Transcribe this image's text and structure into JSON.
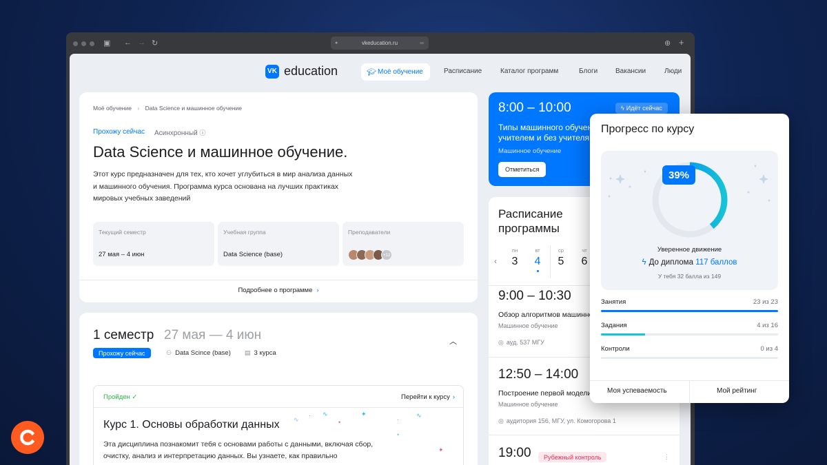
{
  "browser": {
    "url": "vkeducation.ru"
  },
  "nav": {
    "logo_vk": "VK",
    "logo_text": "education",
    "items": [
      "Моё обучение",
      "Расписание",
      "Каталог программ",
      "Блоги",
      "Вакансии",
      "Люди"
    ]
  },
  "course_card": {
    "breadcrumb": [
      "Моё обучение",
      "Data Science и машинное обучение"
    ],
    "status": "Прохожу сейчас",
    "mode": "Асинхронный",
    "title": "Data Science и машинное обучение.",
    "description": "Этот курс предназначен для тех, кто хочет углубиться в мир анализа данных и машинного обучения. Программа курса основана на лучших практиках мировых учебных заведений",
    "info": [
      {
        "label": "Текущий семестр",
        "value": "27 мая – 4 июн"
      },
      {
        "label": "Учебная группа",
        "value": "Data Science (base)"
      },
      {
        "label": "Преподаватели",
        "value": "+12"
      }
    ],
    "more_link": "Подробнее о программе"
  },
  "semester": {
    "title": "1 семестр",
    "dates": "27 мая — 4 июн",
    "status": "Прохожу сейчас",
    "group": "Data Scince (base)",
    "courses": "3 курса",
    "course": {
      "status": "Пройден",
      "goto": "Перейти к курсу",
      "title": "Курс 1. Основы обработки данных",
      "description": "Эта дисциплина познакомит тебя с основами работы с данными, включая сбор, очистку, анализ и интерпретацию данных. Вы узнаете, как правильно"
    }
  },
  "current_lesson": {
    "time": "8:00 – 10:00",
    "badge": "Идёт сейчас",
    "title": "Типы машинного обучения: с учителем и без учителя",
    "course": "Машинное обучение",
    "button": "Отметиться"
  },
  "schedule": {
    "title": "Расписание программы",
    "days": [
      {
        "weekday": "пн",
        "num": "3",
        "active": false
      },
      {
        "weekday": "вт",
        "num": "4",
        "active": true
      },
      {
        "weekday": "ср",
        "num": "5",
        "active": false
      },
      {
        "weekday": "чт",
        "num": "6",
        "active": false
      }
    ],
    "events": [
      {
        "time": "9:00 – 10:30",
        "title": "Обзор алгоритмов машинного обучения",
        "course": "Машинное обучение",
        "location": "ауд. 537 МГУ"
      },
      {
        "time": "12:50 – 14:00",
        "title": "Построение первой модели",
        "course": "Машинное обучение",
        "location": "аудитория 156, МГУ, ул. Комогорова 1"
      },
      {
        "time": "19:00",
        "badge": "Рубежный контроль"
      }
    ]
  },
  "progress": {
    "title": "Прогресс по курсу",
    "percent": 39,
    "percent_label": "39%",
    "status": "Уверенное движение",
    "to_diploma": "До диплома",
    "points": "117 баллов",
    "summary": "У тебя 32 балла из 149",
    "rows": [
      {
        "label": "Занятия",
        "value": "23 из 23",
        "done": 23,
        "total": 23
      },
      {
        "label": "Задания",
        "value": "4 из 16",
        "done": 4,
        "total": 16
      },
      {
        "label": "Контроли",
        "value": "0 из 4",
        "done": 0,
        "total": 4
      }
    ],
    "buttons": [
      "Моя успеваемость",
      "Мой рейтинг"
    ]
  },
  "colors": {
    "accent": "#0077ff",
    "success": "#2bb24c",
    "danger": "#e0345c",
    "brand_orange": "#ff5a1f",
    "progress_cyan": "#17c3d6"
  }
}
